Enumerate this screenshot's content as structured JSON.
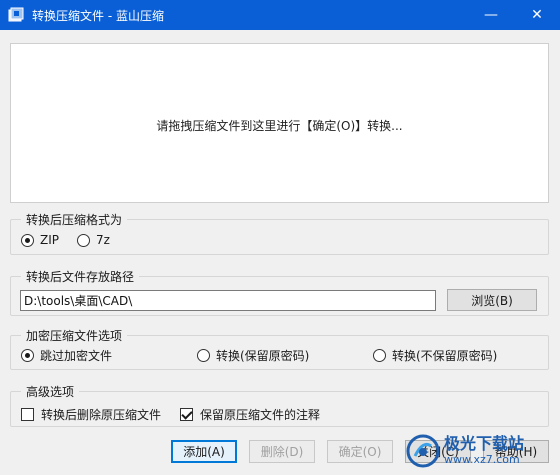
{
  "window": {
    "title": "转换压缩文件 - 蓝山压缩",
    "minimize_glyph": "—",
    "close_glyph": "✕"
  },
  "dropzone": {
    "hint": "请拖拽压缩文件到这里进行【确定(O)】转换..."
  },
  "format_group": {
    "title": "转换后压缩格式为",
    "options": [
      {
        "label": "ZIP",
        "selected": true
      },
      {
        "label": "7z",
        "selected": false
      }
    ]
  },
  "path_group": {
    "title": "转换后文件存放路径",
    "path_value": "D:\\tools\\桌面\\CAD\\",
    "browse_label": "浏览(B)"
  },
  "encrypt_group": {
    "title": "加密压缩文件选项",
    "options": [
      {
        "label": "跳过加密文件",
        "selected": true
      },
      {
        "label": "转换(保留原密码)",
        "selected": false
      },
      {
        "label": "转换(不保留原密码)",
        "selected": false
      }
    ]
  },
  "advanced_group": {
    "title": "高级选项",
    "options": [
      {
        "label": "转换后删除原压缩文件",
        "checked": false
      },
      {
        "label": "保留原压缩文件的注释",
        "checked": true
      }
    ]
  },
  "buttons": {
    "add": "添加(A)",
    "delete": "删除(D)",
    "ok": "确定(O)",
    "close": "关闭(C)",
    "help": "帮助(H)"
  },
  "watermark": {
    "title": "极光下载站",
    "url": "www.xz7.com"
  },
  "colors": {
    "titlebar": "#0a5fd6",
    "watermark": "#1f5fae"
  }
}
